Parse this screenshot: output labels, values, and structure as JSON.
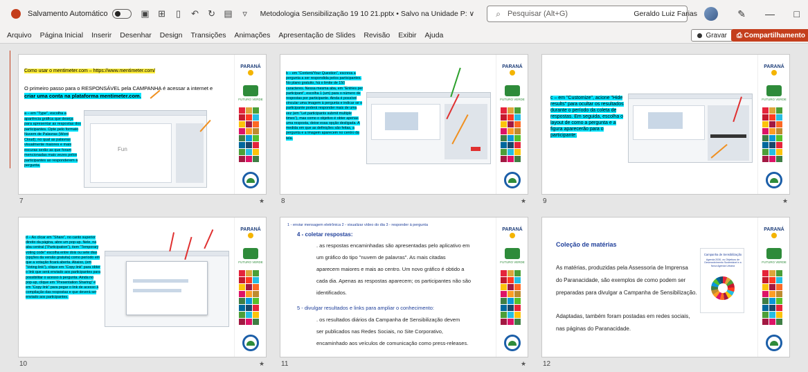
{
  "titlebar": {
    "autosave_label": "Salvamento Automático",
    "doc_name": "Metodologia Sensibilização 19 10 21.pptx • Salvo na Unidade P: ∨",
    "search_placeholder": "Pesquisar (Alt+G)",
    "user_name": "Geraldo Luiz Farias",
    "autosave_state": "off"
  },
  "menu": {
    "items": [
      "Arquivo",
      "Página Inicial",
      "Inserir",
      "Desenhar",
      "Design",
      "Transições",
      "Animações",
      "Apresentação de Slides",
      "Revisão",
      "Exibir",
      "Ajuda"
    ],
    "record_label": "Gravar",
    "share_label": "Compartilhamento"
  },
  "sidebar_logo": {
    "parana": "PARANÁ",
    "futuro": "FUTURO VERDE"
  },
  "slides": [
    {
      "number": "7",
      "title_link": "Como usar o mentimeter.com – https://www.mentimeter.com/",
      "line1": "O primeiro passo para o RESPONSÁVEL pela CAMPANHA é acessar a internet e",
      "line2": "criar uma conta na plataforma mentimeter.com.",
      "body": "a – em \"Type\", escolha a aparência gráfica que deseja para apresentar as respostas dos participantes. Opte pelo formato Nuvem de Palavras (Word Cloud), no qual as palavras visualmente maiores e mais escuras serão as que foram mencionadas mais vezes pelos participantes ao responderem à pergunta."
    },
    {
      "number": "8",
      "body": "b – em \"Content/Your Question\", escreva a pergunta a ser respondida pelos participantes. No plano gratuito, há o limite de 150 caracteres. Nessa mesma aba, em \"Entries per participant\", escolha 1 (um) para o número de respostas por participante. Ainda é possível vincular uma imagem à pergunta e indicar se o participante poderá responder mais de uma vez (em \"Let participants submit multiple times\"), mas como o objetivo é obter apenas uma resposta, deixe essa opção desligada. A medida em que as definições são feitas, a pergunta e a imagem aparecem no centro da tela."
    },
    {
      "number": "9",
      "body": "c – em \"Customize\", acione \"Hide results\" para ocultar os resultados durante o período da coleta de respostas. Em seguida, escolha o layout de como a pergunta e a figura aparecerão para o participante."
    },
    {
      "number": "10",
      "body": "d – Ao clicar em \"Share\", no canto superior direito da página, abre um pop-up. Nele, na aba central (\"Participation\"), item \"Temporary voting code\" escolha entre dois ou sete dias (opções da versão gratuita) como período em que a votação ficará aberta. Abaixo, (em \"Voting link\"), clique em \"Copy link\" para obter o link que será enviado aos participantes para possibilitar o acesso à pergunta. Ainda no pop-up, clique em \"Presentation Sharing\" e em \"Copy link\" para pegar o link de acesso à compilação das respostas e que deverá ser enviado aos participantes."
    },
    {
      "number": "11",
      "header": "1 - enviar mensagem eletrônica    2 - visualizar vídeo do dia    3 - responder à pergunta",
      "h4": "4 - coletar respostas:",
      "p4": [
        ". as respostas encaminhadas são apresentadas pelo aplicativo em",
        "um gráfico do tipo \"nuvem de palavras\". As mais citadas",
        "aparecem maiores e mais ao centro. Um novo gráfico é obtido a",
        "cada dia. Apenas as respostas aparecem; os participantes não são",
        "identificados."
      ],
      "h5": "5 - divulgar resultados e links para ampliar o conhecimento:",
      "p5": [
        ". os resultados diários da Campanha de Sensibilização devem",
        "ser publicados nas Redes Sociais, no Site Corporativo,",
        "encaminhado aos veículos de comunicação como press-releases."
      ]
    },
    {
      "number": "12",
      "heading": "Coleção de matérias",
      "p1": [
        "As matérias, produzidas pela Assessoria de Imprensa",
        "do Paranacidade, são exemplos de como podem ser",
        "preparadas para divulgar a Campanha de Sensibilização."
      ],
      "p2": [
        "Adaptadas, também foram postadas em redes sociais,",
        "nas páginas do Paranacidade."
      ],
      "poster_title": "Campanha de Sensibilização",
      "poster_sub": "Agenda 2030, os Objetivos de Desenvolvimento Sustentável e a Nova Agenda Urbana"
    }
  ],
  "colors": {
    "accent": "#c43e1c",
    "highlight": "#00e5ff",
    "heading_blue": "#1f3f9a"
  }
}
